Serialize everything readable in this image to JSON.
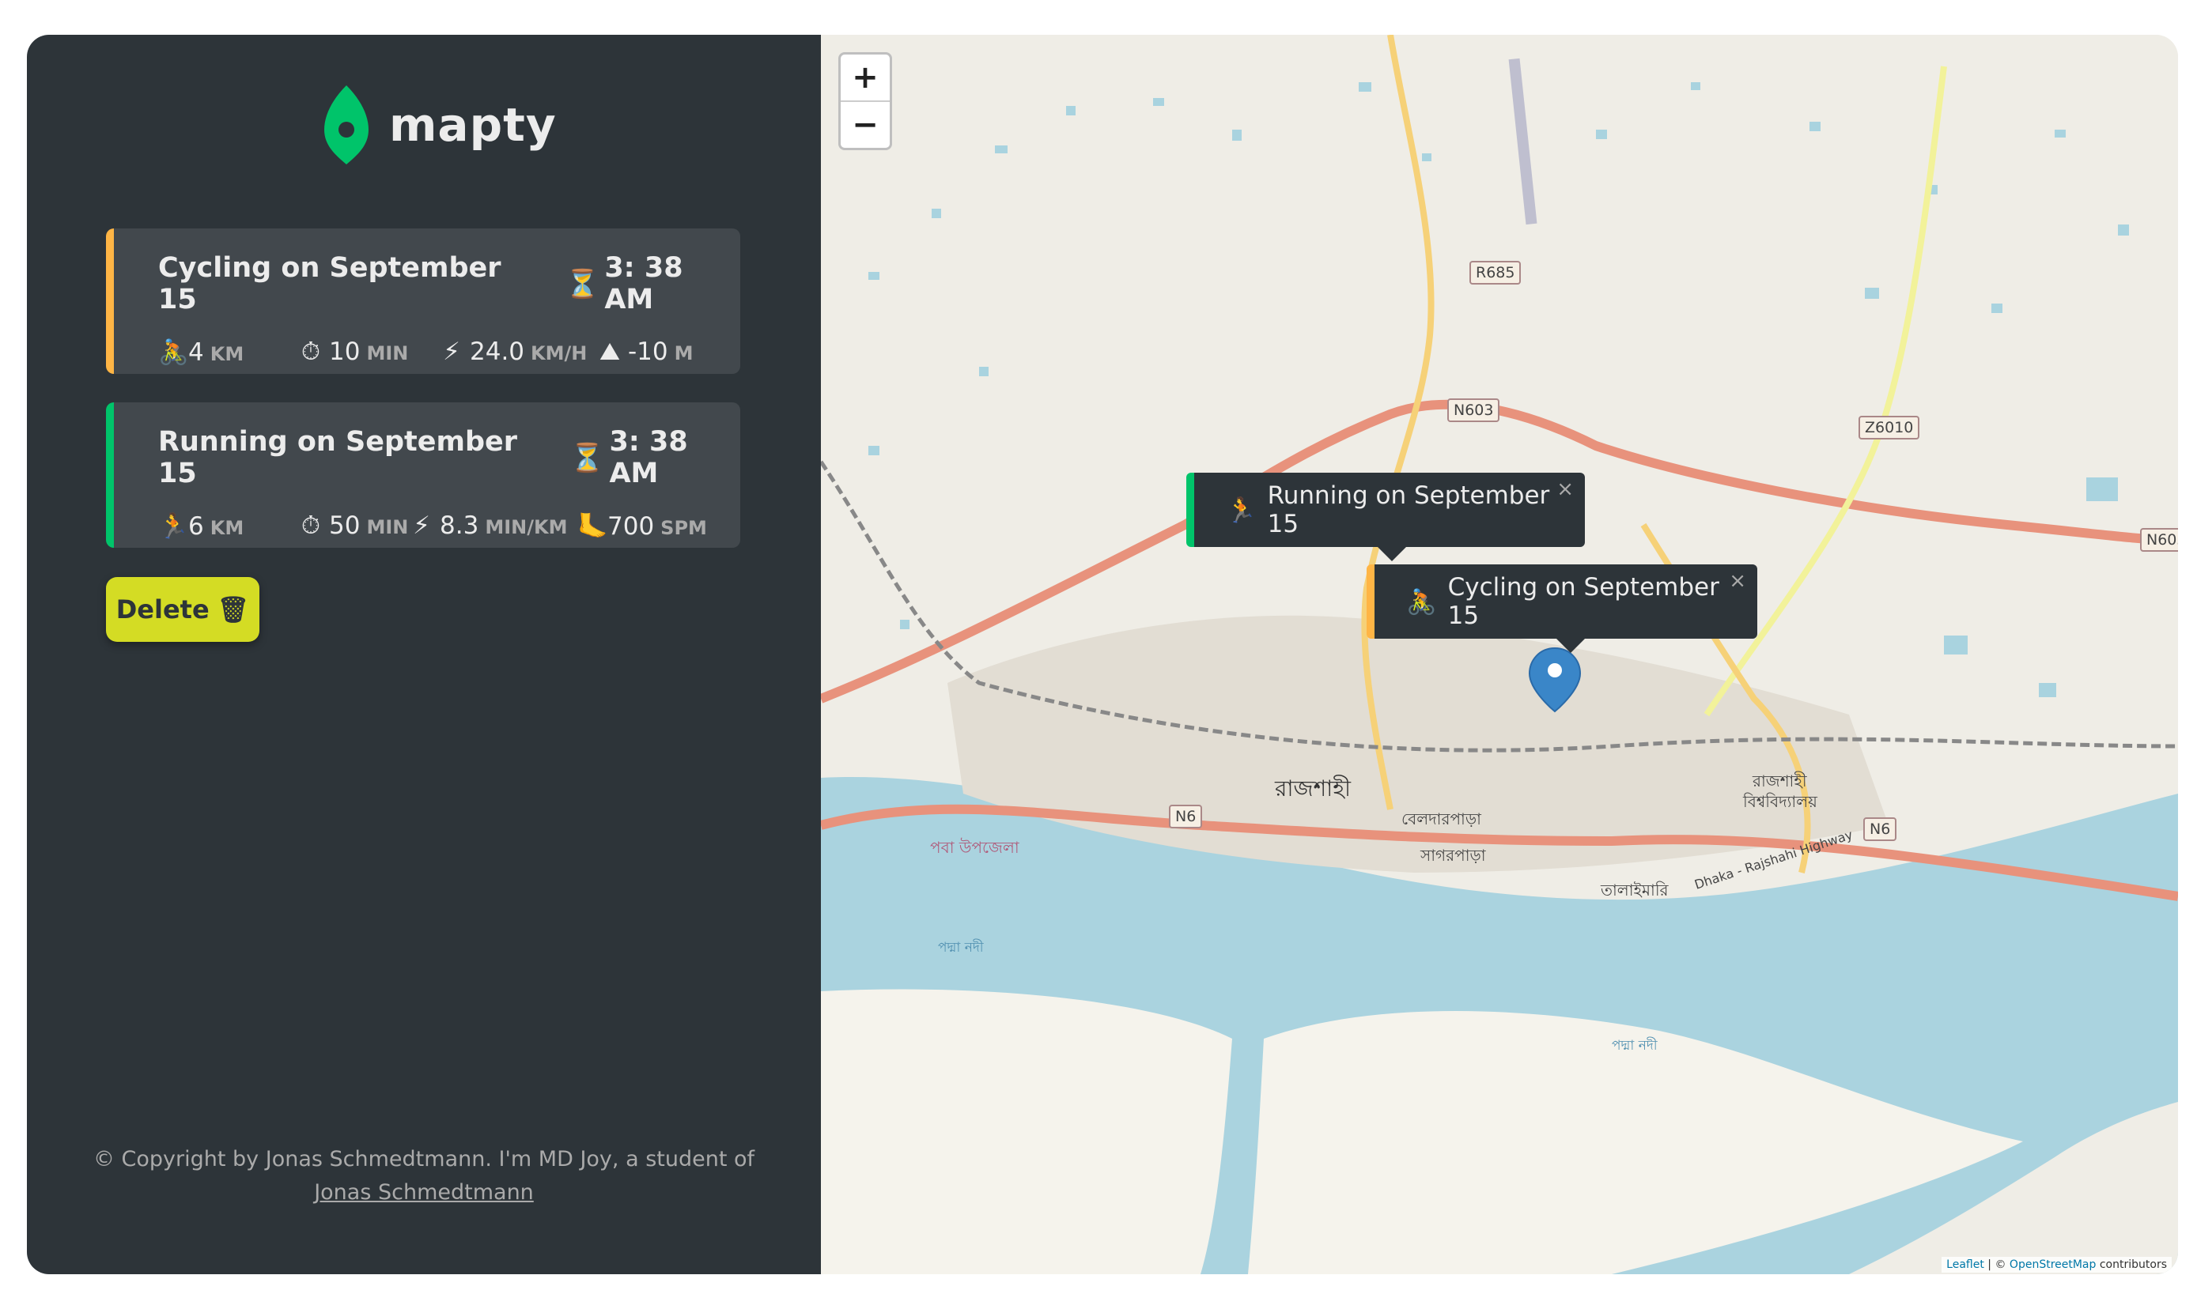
{
  "app": {
    "name": "mapty"
  },
  "workouts": [
    {
      "type": "cycling",
      "title": "Cycling on September 15",
      "time": "3: 38 AM",
      "color": "#ffb545",
      "stats": [
        {
          "icon": "🚴",
          "value": "4",
          "unit": "km"
        },
        {
          "icon": "⏱",
          "value": "10",
          "unit": "min"
        },
        {
          "icon": "⚡",
          "value": "24.0",
          "unit": "km/h"
        },
        {
          "icon": "⛰",
          "value": "-10",
          "unit": "m"
        }
      ]
    },
    {
      "type": "running",
      "title": "Running on September 15",
      "time": "3: 38 AM",
      "color": "#00c46a",
      "stats": [
        {
          "icon": "🏃",
          "value": "6",
          "unit": "km"
        },
        {
          "icon": "⏱",
          "value": "50",
          "unit": "min"
        },
        {
          "icon": "⚡",
          "value": "8.3",
          "unit": "min/km"
        },
        {
          "icon": "🦶",
          "value": "700",
          "unit": "spm"
        }
      ]
    }
  ],
  "delete_button": {
    "label": "Delete",
    "icon": "🗑"
  },
  "copyright": {
    "text": "© Copyright by Jonas Schmedtmann. I'm MD Joy, a student of",
    "link_text": "Jonas Schmedtmann"
  },
  "map": {
    "zoom_in": "+",
    "zoom_out": "−",
    "popups": [
      {
        "icon": "🏃",
        "text": "Running on September 15",
        "close": "×"
      },
      {
        "icon": "🚴",
        "text": "Cycling on September 15",
        "close": "×"
      }
    ],
    "attribution": {
      "leaflet": "Leaflet",
      "sep": " | © ",
      "osm": "OpenStreetMap",
      "tail": " contributors"
    },
    "labels": {
      "city": "রাজশাহী",
      "area1": "বেলদারপাড়া",
      "area2": "সাগরপাড়া",
      "area3": "তালাইমারি",
      "univ1": "রাজশাহী",
      "univ2": "বিশ্ববিদ্যালয়",
      "river1": "পদ্মা নদী",
      "river2": "পদ্মা নদী",
      "upazila": "পবা উপজেলা",
      "highway": "Dhaka - Rajshahi Highway",
      "n603": "N603",
      "n603b": "N603",
      "n6a": "N6",
      "n6b": "N6",
      "r685": "R685",
      "z6010": "Z6010"
    }
  }
}
